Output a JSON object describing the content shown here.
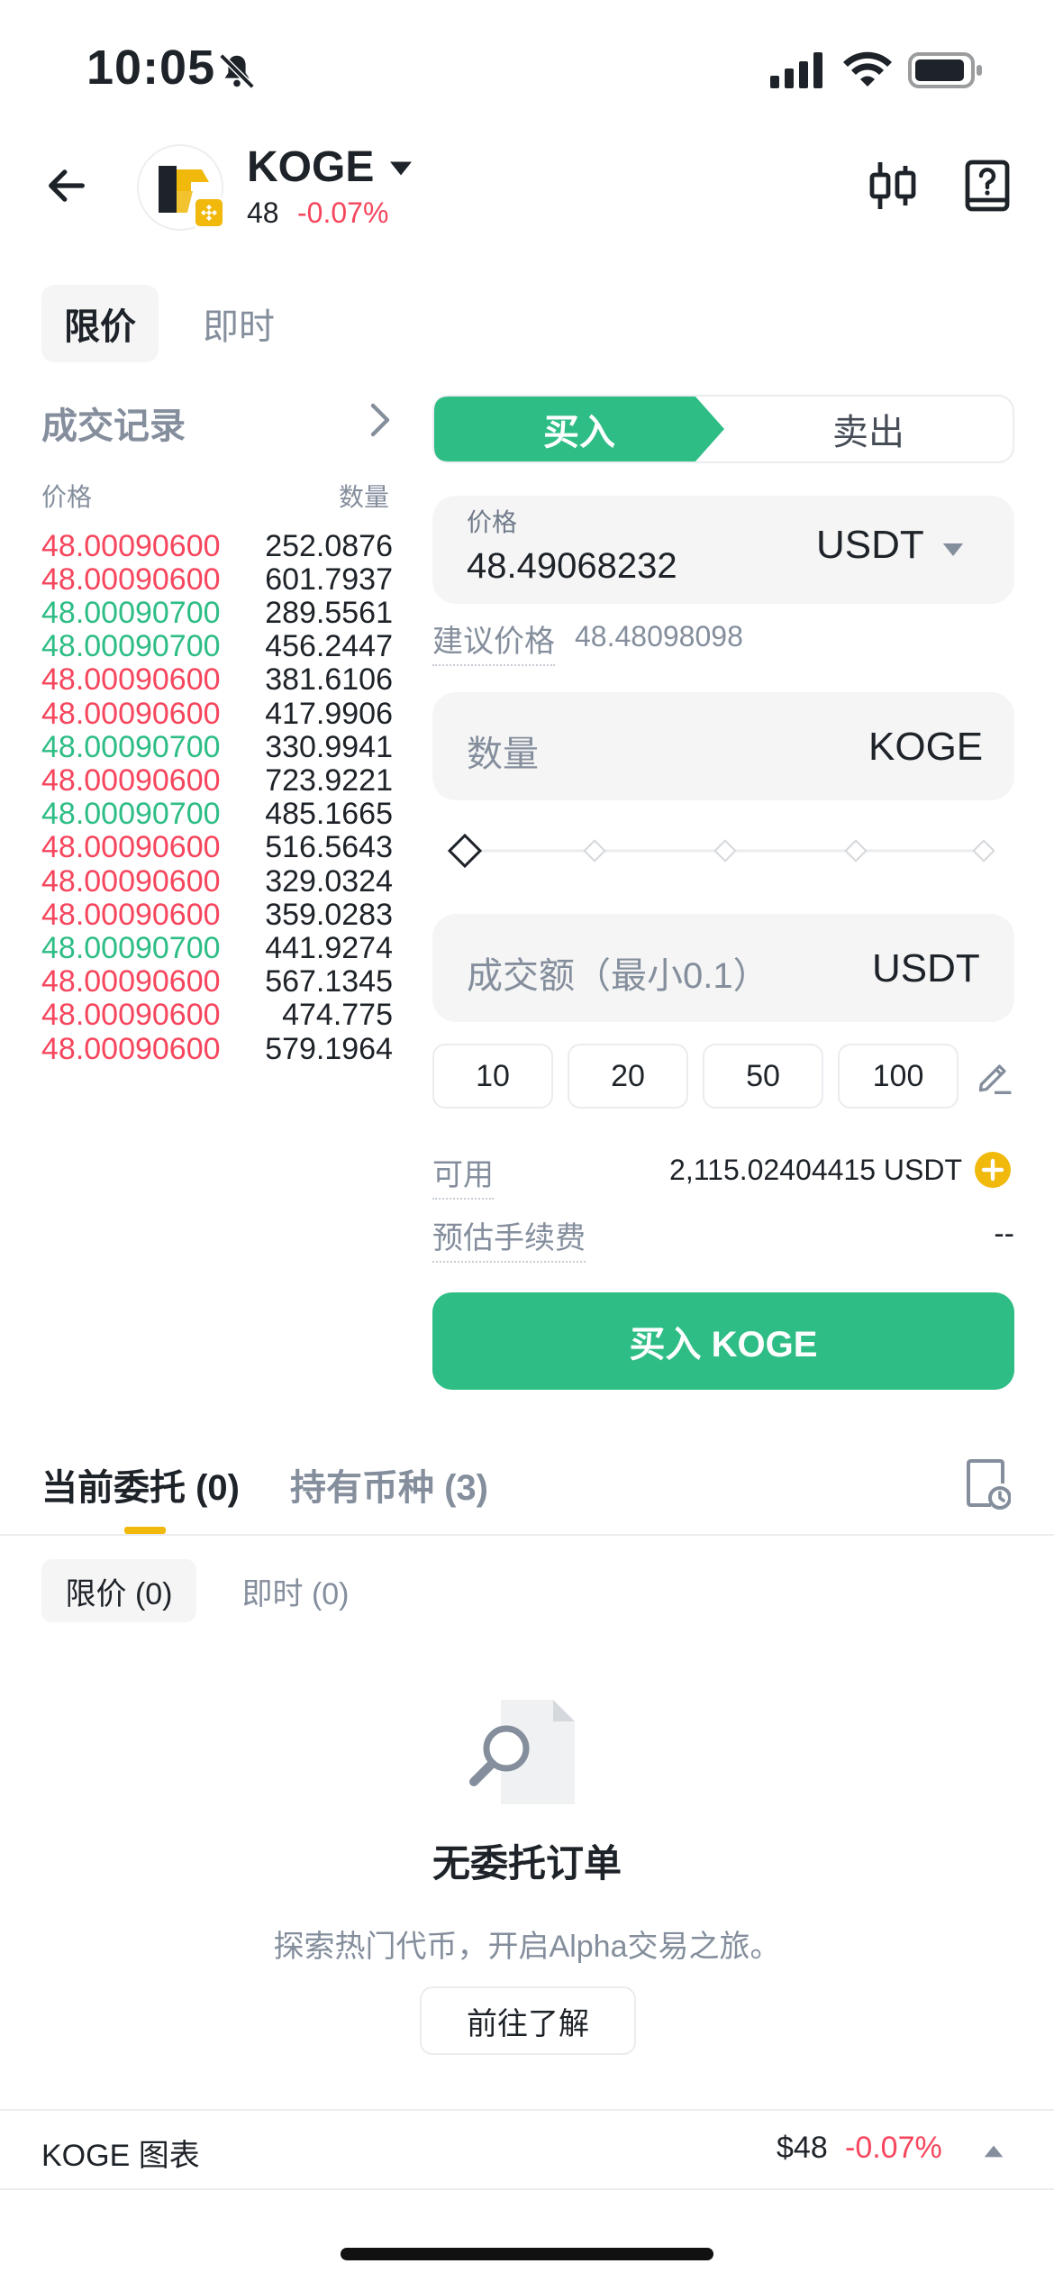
{
  "status_bar": {
    "time": "10:05"
  },
  "header": {
    "token_name": "KOGE",
    "price": "48",
    "change": "-0.07%"
  },
  "order_types": {
    "limit": "限价",
    "instant": "即时"
  },
  "trades": {
    "title": "成交记录",
    "price_header": "价格",
    "qty_header": "数量",
    "rows": [
      {
        "price": "48.00090600",
        "qty": "252.0876",
        "side": "sell"
      },
      {
        "price": "48.00090600",
        "qty": "601.7937",
        "side": "sell"
      },
      {
        "price": "48.00090700",
        "qty": "289.5561",
        "side": "buy"
      },
      {
        "price": "48.00090700",
        "qty": "456.2447",
        "side": "buy"
      },
      {
        "price": "48.00090600",
        "qty": "381.6106",
        "side": "sell"
      },
      {
        "price": "48.00090600",
        "qty": "417.9906",
        "side": "sell"
      },
      {
        "price": "48.00090700",
        "qty": "330.9941",
        "side": "buy"
      },
      {
        "price": "48.00090600",
        "qty": "723.9221",
        "side": "sell"
      },
      {
        "price": "48.00090700",
        "qty": "485.1665",
        "side": "buy"
      },
      {
        "price": "48.00090600",
        "qty": "516.5643",
        "side": "sell"
      },
      {
        "price": "48.00090600",
        "qty": "329.0324",
        "side": "sell"
      },
      {
        "price": "48.00090600",
        "qty": "359.0283",
        "side": "sell"
      },
      {
        "price": "48.00090700",
        "qty": "441.9274",
        "side": "buy"
      },
      {
        "price": "48.00090600",
        "qty": "567.1345",
        "side": "sell"
      },
      {
        "price": "48.00090600",
        "qty": "474.775",
        "side": "sell"
      },
      {
        "price": "48.00090600",
        "qty": "579.1964",
        "side": "sell"
      }
    ]
  },
  "order_form": {
    "buy_label": "买入",
    "sell_label": "卖出",
    "price_label": "价格",
    "price_value": "48.49068232",
    "price_unit": "USDT",
    "suggest_label": "建议价格",
    "suggest_value": "48.48098098",
    "qty_placeholder": "数量",
    "qty_unit": "KOGE",
    "amount_placeholder": "成交额（最小0.1）",
    "amount_unit": "USDT",
    "presets": [
      "10",
      "20",
      "50",
      "100"
    ],
    "available_label": "可用",
    "available_value": "2,115.02404415 USDT",
    "fee_label": "预估手续费",
    "fee_value": "--",
    "submit_label": "买入 KOGE"
  },
  "orders": {
    "tab_open": "当前委托 (0)",
    "tab_holdings": "持有币种 (3)",
    "sub_limit": "限价 (0)",
    "sub_instant": "即时 (0)",
    "empty_title": "无委托订单",
    "empty_desc": "探索热门代币，开启Alpha交易之旅。",
    "learn_button": "前往了解"
  },
  "footer": {
    "label": "KOGE 图表",
    "price": "$48",
    "change": "-0.07%"
  },
  "colors": {
    "buy_green": "#2ebd85",
    "sell_red": "#f6465d",
    "accent_yellow": "#f0b90b"
  }
}
